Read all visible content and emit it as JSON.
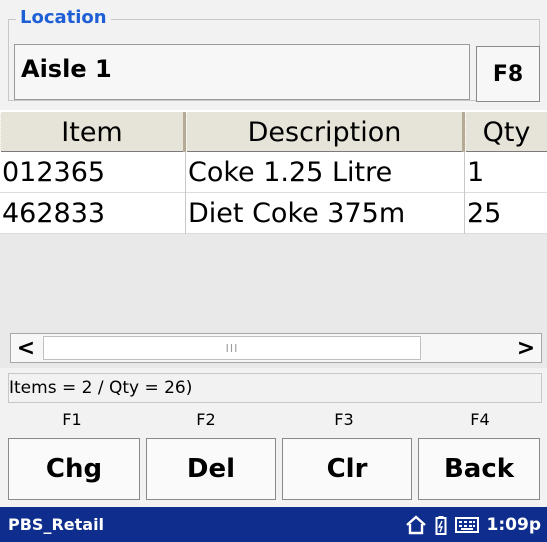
{
  "location": {
    "legend": "Location",
    "value": "Aisle 1",
    "lookup_label": "F8"
  },
  "grid": {
    "columns": [
      "Item",
      "Description",
      "Qty"
    ],
    "rows": [
      {
        "item": "012365",
        "description": "Coke 1.25 Litre",
        "qty": "1"
      },
      {
        "item": "462833",
        "description": "Diet Coke 375m",
        "qty": "25"
      }
    ]
  },
  "scrollbar": {
    "left_arrow": "<",
    "right_arrow": ">",
    "thumb_grip": "III"
  },
  "status": {
    "text": "Items = 2 / Qty = 26)"
  },
  "function_keys": [
    "F1",
    "F2",
    "F3",
    "F4"
  ],
  "buttons": [
    "Chg",
    "Del",
    "Clr",
    "Back"
  ],
  "taskbar": {
    "app_name": "PBS_Retail",
    "time": "1:09p",
    "icons": [
      "home-icon",
      "battery-icon",
      "keyboard-icon"
    ]
  }
}
